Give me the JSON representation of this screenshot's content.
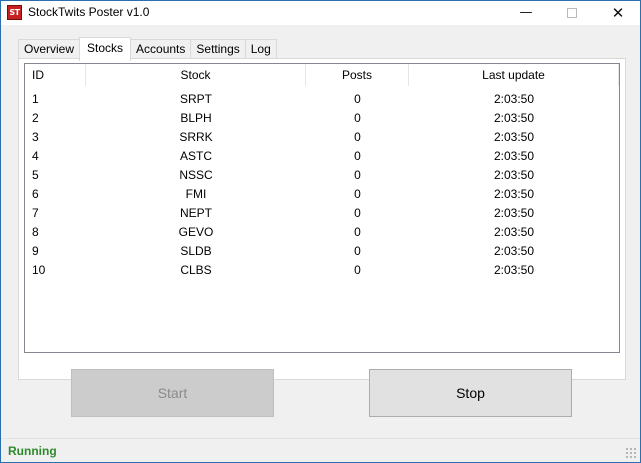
{
  "window": {
    "title": "StockTwits Poster v1.0",
    "icon_label": "ST",
    "controls": {
      "minimize": "—",
      "close": "✕"
    }
  },
  "tabs": [
    {
      "label": "Overview",
      "active": false
    },
    {
      "label": "Stocks",
      "active": true
    },
    {
      "label": "Accounts",
      "active": false
    },
    {
      "label": "Settings",
      "active": false
    },
    {
      "label": "Log",
      "active": false
    }
  ],
  "stocks_table": {
    "columns": [
      "ID",
      "Stock",
      "Posts",
      "Last update"
    ],
    "rows": [
      {
        "id": "1",
        "stock": "SRPT",
        "posts": "0",
        "last_update": "2:03:50"
      },
      {
        "id": "2",
        "stock": "BLPH",
        "posts": "0",
        "last_update": "2:03:50"
      },
      {
        "id": "3",
        "stock": "SRRK",
        "posts": "0",
        "last_update": "2:03:50"
      },
      {
        "id": "4",
        "stock": "ASTC",
        "posts": "0",
        "last_update": "2:03:50"
      },
      {
        "id": "5",
        "stock": "NSSC",
        "posts": "0",
        "last_update": "2:03:50"
      },
      {
        "id": "6",
        "stock": "FMI",
        "posts": "0",
        "last_update": "2:03:50"
      },
      {
        "id": "7",
        "stock": "NEPT",
        "posts": "0",
        "last_update": "2:03:50"
      },
      {
        "id": "8",
        "stock": "GEVO",
        "posts": "0",
        "last_update": "2:03:50"
      },
      {
        "id": "9",
        "stock": "SLDB",
        "posts": "0",
        "last_update": "2:03:50"
      },
      {
        "id": "10",
        "stock": "CLBS",
        "posts": "0",
        "last_update": "2:03:50"
      }
    ]
  },
  "buttons": {
    "start_label": "Start",
    "start_enabled": false,
    "stop_label": "Stop",
    "stop_enabled": true
  },
  "status": {
    "text": "Running",
    "color": "#2e8b2e"
  },
  "colors": {
    "window_border": "#2a6fb0",
    "icon_red": "#c62020"
  }
}
